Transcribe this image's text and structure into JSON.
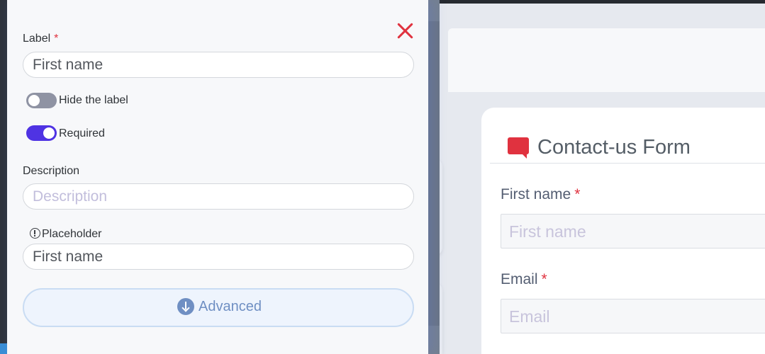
{
  "panel": {
    "label_field": {
      "title": "Label",
      "required_mark": "*",
      "value": "First name"
    },
    "hide_label_toggle": {
      "label": "Hide the label",
      "on": false
    },
    "required_toggle": {
      "label": "Required",
      "on": true
    },
    "description_field": {
      "title": "Description",
      "placeholder": "Description"
    },
    "placeholder_field": {
      "title": "Placeholder",
      "value": "First name"
    },
    "advanced_button": {
      "label": "Advanced"
    }
  },
  "form": {
    "title": "Contact-us Form",
    "fields": [
      {
        "label": "First name",
        "required_mark": "*",
        "placeholder": "First name"
      },
      {
        "label": "Email",
        "required_mark": "*",
        "placeholder": "Email"
      }
    ]
  },
  "colors": {
    "accent_red": "#e0323f",
    "toggle_on": "#4f33e3",
    "toggle_off": "#8f93a3",
    "advanced_blue": "#6f8fc3"
  },
  "icons": [
    "close-icon",
    "info-icon",
    "arrow-down-circle-icon",
    "chat-bubble-icon"
  ]
}
